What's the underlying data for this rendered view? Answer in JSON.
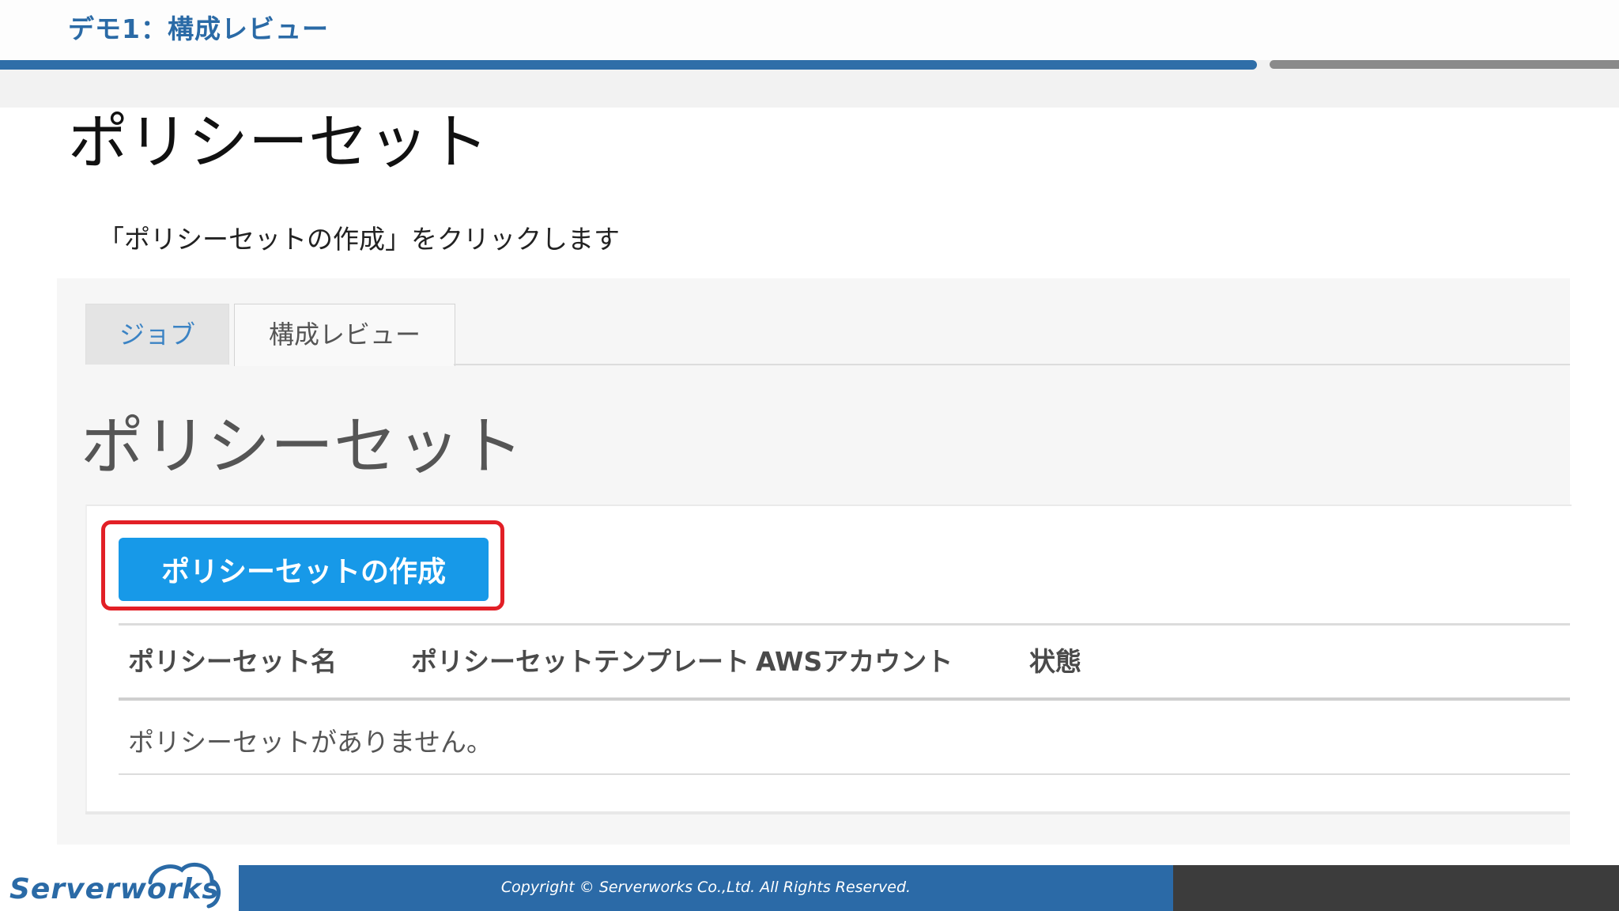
{
  "slide": {
    "header_title": "デモ1：構成レビュー",
    "title": "ポリシーセット",
    "instruction": "「ポリシーセットの作成」をクリックします"
  },
  "screenshot": {
    "tabs": [
      {
        "label": "ジョブ",
        "active": false
      },
      {
        "label": "構成レビュー",
        "active": true
      }
    ],
    "page_heading": "ポリシーセット",
    "create_button_label": "ポリシーセットの作成",
    "table": {
      "columns": [
        "ポリシーセット名",
        "ポリシーセットテンプレート",
        "AWSアカウント",
        "状態"
      ],
      "empty_message": "ポリシーセットがありません。"
    }
  },
  "footer": {
    "logo_text": "Serverworks",
    "copyright": "Copyright ©  Serverworks Co.,Ltd. All Rights Reserved."
  },
  "colors": {
    "brand_blue": "#2b6aa7",
    "button_blue": "#1799e8",
    "highlight_red": "#e21f26",
    "footer_dark": "#3c3c3c"
  }
}
